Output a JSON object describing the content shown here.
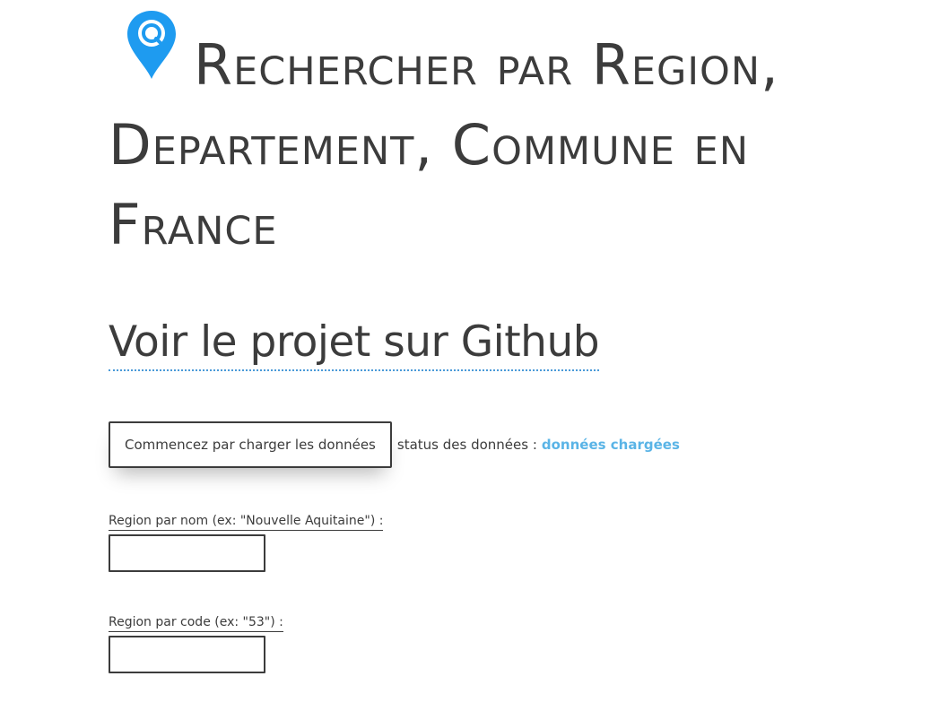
{
  "header": {
    "title": "Rechercher par Region, Departement, Commune en France",
    "icon": "location-search-pin-icon",
    "icon_color": "#1e9bf0"
  },
  "github": {
    "link_text": "Voir le projet sur Github"
  },
  "loader": {
    "button_label": "Commencez par charger les données",
    "status_label": "status des données :",
    "status_value": "données chargées",
    "status_color": "#5ab4e6"
  },
  "fields": [
    {
      "label": "Region par nom (ex: \"Nouvelle Aquitaine\") :",
      "value": "",
      "placeholder": ""
    },
    {
      "label": "Region par code (ex: \"53\") :",
      "value": "",
      "placeholder": ""
    }
  ]
}
